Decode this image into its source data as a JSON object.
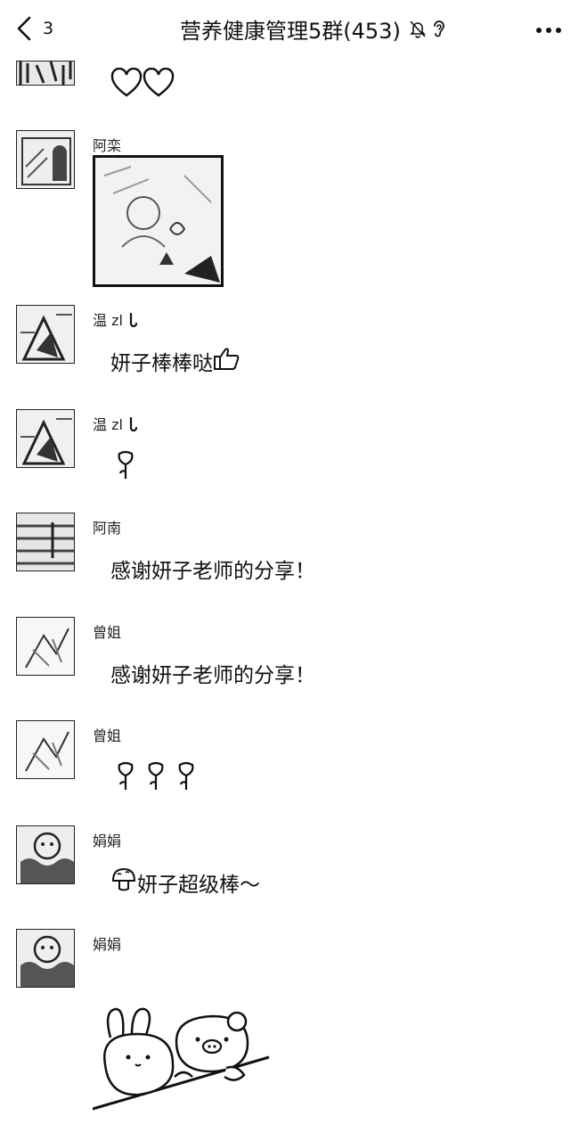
{
  "header": {
    "back_icon": "chevron-left-icon",
    "unread_count": "3",
    "title": "营养健康管理5群(453)",
    "mute_icon": "bell-muted-icon",
    "earpiece_icon": "ear-icon",
    "more_icon": "more-dots-icon"
  },
  "messages": [
    {
      "sender": "",
      "content": "",
      "content_icons": [
        "heart-outline-icon",
        "heart-outline-icon"
      ]
    },
    {
      "sender": "阿栾",
      "content_type": "image"
    },
    {
      "sender": "温 zl",
      "content": "妍子棒棒哒",
      "content_icons": [
        "thumbs-up-icon"
      ]
    },
    {
      "sender": "温 zl",
      "content_icons": [
        "rose-icon"
      ]
    },
    {
      "sender": "阿南",
      "content": "感谢妍子老师的分享！"
    },
    {
      "sender": "曾姐",
      "content": "感谢妍子老师的分享！"
    },
    {
      "sender": "曾姐",
      "content_icons": [
        "rose-icon",
        "rose-icon",
        "rose-icon"
      ]
    },
    {
      "sender": "娟娟",
      "content": "妍子超级棒～",
      "content_icons": [
        "mushroom-icon"
      ]
    },
    {
      "sender": "娟娟",
      "content_type": "sticker",
      "sticker_icon": "bunny-bear-sticker"
    }
  ]
}
